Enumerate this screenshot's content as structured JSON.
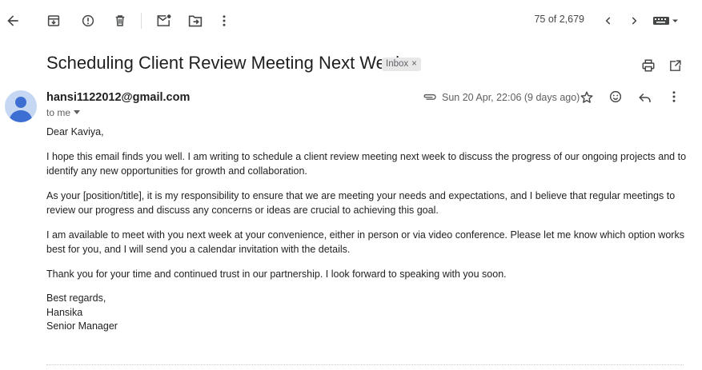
{
  "toolbar": {
    "icons": [
      "back-arrow-icon",
      "archive-icon",
      "report-spam-icon",
      "delete-icon",
      "mark-unread-icon",
      "move-to-icon",
      "more-vert-icon"
    ],
    "pager_text": "75 of 2,679"
  },
  "email": {
    "subject": "Scheduling Client Review Meeting Next Week",
    "label": "Inbox",
    "label_remove": "×",
    "sender": "hansi1122012@gmail.com",
    "to_text": "to me",
    "date": "Sun 20 Apr, 22:06 (9 days ago)",
    "greeting": "Dear Kaviya,",
    "paragraphs": [
      "I hope this email finds you well. I am writing to schedule a client review meeting next week to discuss the progress of our ongoing projects and to identify any new opportunities for growth and collaboration.",
      "As your [position/title], it is my responsibility to ensure that we are meeting your needs and expectations, and I believe that regular meetings to review our progress and discuss any concerns or ideas are crucial to achieving this goal.",
      "I am available to meet with you next week at your convenience, either in person or via video conference. Please let me know which option works best for you, and I will send you a calendar invitation with the details.",
      "Thank you for your time and continued trust in our partnership. I look forward to speaking with you soon."
    ],
    "closing": "Best regards,",
    "signature_name": "Hansika",
    "signature_title": "Senior Manager"
  },
  "colors": {
    "icon": "#444746",
    "avatar_bg": "#c5d7f2",
    "avatar_fg": "#3c6fd1"
  }
}
